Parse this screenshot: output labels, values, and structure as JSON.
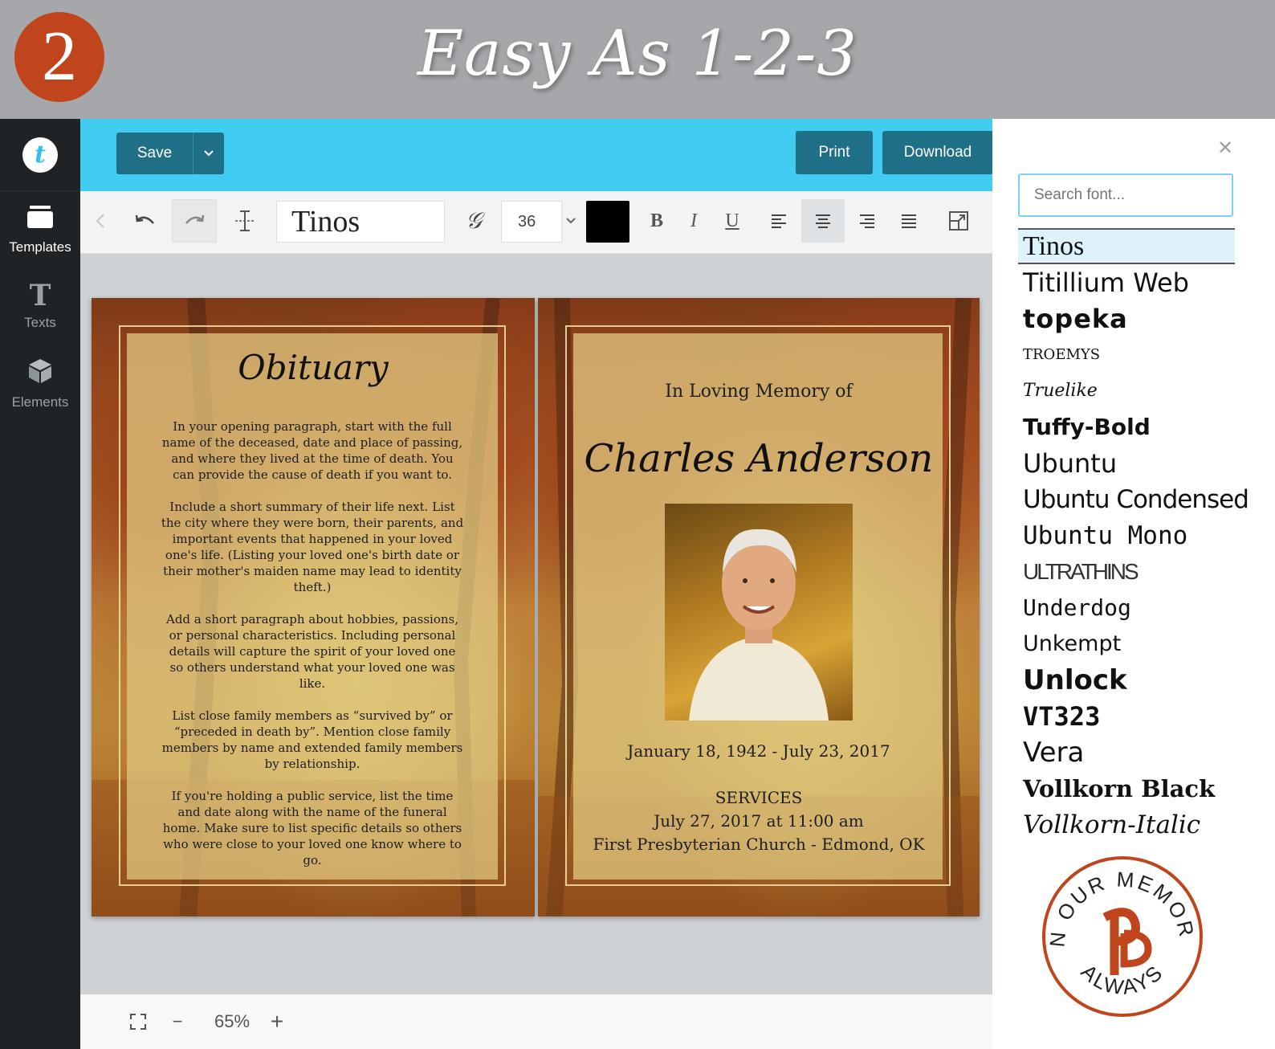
{
  "banner": {
    "step_number": "2",
    "title": "Easy As 1-2-3"
  },
  "sidebar": {
    "logo_letter": "t",
    "items": [
      {
        "label": "Templates",
        "icon": "templates-icon",
        "active": true
      },
      {
        "label": "Texts",
        "icon": "texts-icon",
        "active": false
      },
      {
        "label": "Elements",
        "icon": "elements-icon",
        "active": false
      }
    ]
  },
  "topbar": {
    "save_label": "Save",
    "print_label": "Print",
    "download_label": "Download"
  },
  "toolbar": {
    "font_name": "Tinos",
    "font_size": "36",
    "text_color": "#000000",
    "bold": "B",
    "italic": "I",
    "underline": "U"
  },
  "zoom": {
    "level": "65%",
    "minus": "−",
    "plus": "+"
  },
  "obituary": {
    "title": "Obituary",
    "paragraphs": [
      "In your opening paragraph, start with the full name of the deceased, date and place of passing, and where they lived at the time of death. You can provide the cause of death if you want to.",
      "Include a short summary of their life next. List the city where they were born, their parents, and important events that happened in your loved one's life. (Listing your loved one's birth date or their mother's maiden name may lead to identity theft.)",
      "Add a short paragraph about hobbies, passions, or personal characteristics. Including personal details will capture the spirit of your loved one so others understand what your loved one was like.",
      "List close family members as “survived by” or “preceded in death by”. Mention close family members by name and extended family members by relationship.",
      "If you're holding a public service, list the time and date along with the name of the funeral home. Make sure to list specific details so others who were close to your loved one know where to go."
    ]
  },
  "memorial": {
    "heading": "In Loving Memory of",
    "name": "Charles Anderson",
    "dates": "January 18, 1942 - July 23, 2017",
    "services_label": "SERVICES",
    "services_time": "July 27, 2017 at 11:00 am",
    "services_place": "First Presbyterian Church - Edmond, OK"
  },
  "font_panel": {
    "search_placeholder": "Search font...",
    "fonts": [
      "Tinos",
      "Titillium Web",
      "topeka",
      "TROEMYS",
      "Truelike",
      "Tuffy-Bold",
      "Ubuntu",
      "Ubuntu Condensed",
      "Ubuntu Mono",
      "ULTRATHINS",
      "Underdog",
      "Unkempt",
      "Unlock",
      "VT323",
      "Vera",
      "Vollkorn Black",
      "Vollkorn-Italic"
    ],
    "selected_font": "Tinos"
  },
  "colors": {
    "accent": "#41ccf2",
    "button": "#1f6f86",
    "sidebar": "#1f2326",
    "badge": "#c0441c",
    "stamp": "#c0441c"
  }
}
